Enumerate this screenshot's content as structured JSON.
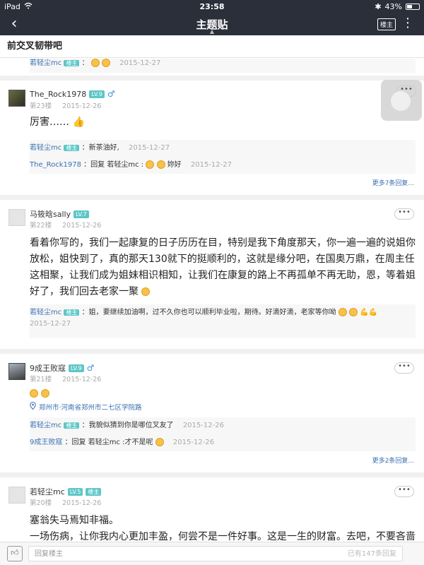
{
  "statusbar": {
    "carrier": "iPad",
    "time": "23:58",
    "battery": "43%",
    "battery_fraction": 0.43
  },
  "navbar": {
    "title": "主题贴",
    "owner_btn": "楼主"
  },
  "forum": {
    "name": "前交叉韧带吧"
  },
  "posts": [
    {
      "reply_first": {
        "who": "若轻尘mc",
        "badge": "楼主",
        "text": "：",
        "time": "2015-12-27"
      }
    },
    {
      "user": "The_Rock1978",
      "level": "LV.9",
      "floor": "第23楼",
      "time": "2015-12-26",
      "body": "厉害……",
      "replies": [
        {
          "who": "若轻尘mc",
          "badge": "楼主",
          "text": "：新茶油好,",
          "time": "2015-12-27"
        },
        {
          "who": "The_Rock1978",
          "text": "：回复 若轻尘mc :",
          "tail": "妳好",
          "time": "2015-12-27"
        }
      ],
      "more": "更多7条回复..."
    },
    {
      "user": "马筱晗sally",
      "level": "LV.7",
      "floor": "第22楼",
      "time": "2015-12-26",
      "body": "看着你写的，我们一起康复的日子历历在目，特别是我下角度那天，你一遍一遍的说姐你放松，姐快到了，真的那天130就下的挺顺利的，这就是缘分吧，在国奥万鼎，在周主任这相聚，让我们成为姐妹相识相知，让我们在康复的路上不再孤单不再无助，恩，等着姐好了，我们回去老家一聚",
      "replies": [
        {
          "who": "若轻尘mc",
          "badge": "楼主",
          "text": "：姐，要继续加油啊，过不久你也可以顺利毕业啦，期待。好滴好滴，老家等你呦",
          "time": "2015-12-27"
        }
      ]
    },
    {
      "user": "9成王败寇",
      "level": "LV.9",
      "floor": "第21楼",
      "time": "2015-12-26",
      "location": "郑州市·河南省郑州市二七区学院路",
      "replies": [
        {
          "who": "若轻尘mc",
          "badge": "楼主",
          "text": "：我貌似猜到你是哪位叉友了",
          "time": "2015-12-26"
        },
        {
          "who": "9成王败寇",
          "text": "：回复 若轻尘mc :才不是呢",
          "time": "2015-12-26"
        }
      ],
      "more": "更多2条回复..."
    },
    {
      "user": "若轻尘mc",
      "level": "LV.5",
      "badge": "楼主",
      "floor": "第20楼",
      "time": "2015-12-26",
      "body1": "塞翁失马焉知非福。",
      "body2": "一场伤病，让你我内心更加丰盈，何尝不是一件好事。这是一生的财富。去吧，不要吝啬自己的拥抱，拥抱这个世界，拥抱所有的美好。（我还顺带拥抱了京城的雾霾，深深"
    }
  ],
  "bottom": {
    "placeholder": "回复楼主",
    "count": "已有147条回复"
  }
}
